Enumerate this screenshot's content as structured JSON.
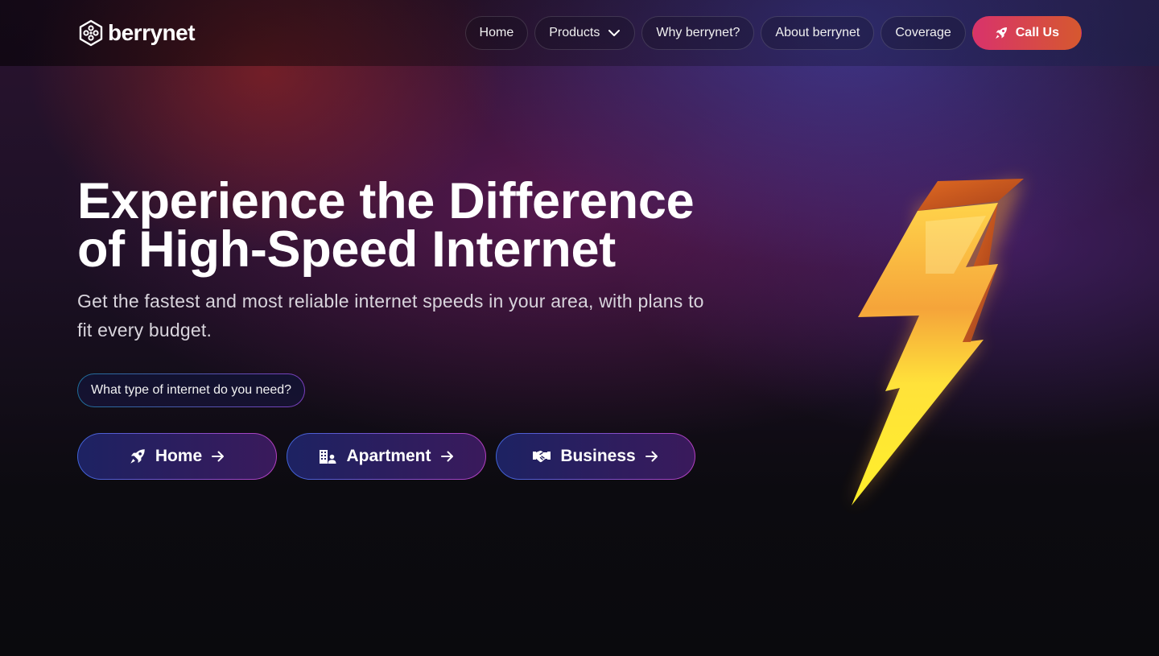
{
  "brand": {
    "name": "berrynet",
    "logo_icon": "berry-network-icon"
  },
  "nav": {
    "items": [
      {
        "label": "Home"
      },
      {
        "label": "Products",
        "icon": "chevron-down-icon"
      },
      {
        "label": "Why berrynet?"
      },
      {
        "label": "About berrynet"
      },
      {
        "label": "Coverage"
      }
    ],
    "cta": {
      "label": "Call Us",
      "icon": "rocket-icon"
    }
  },
  "hero": {
    "title_line1": "Experience the Difference",
    "title_line2": "of High-Speed Internet",
    "subtitle": "Get the fastest and most reliable internet speeds in your area, with plans to fit every budget.",
    "question": "What type of internet do you need?",
    "choices": [
      {
        "label": "Home",
        "icon": "rocket-icon"
      },
      {
        "label": "Apartment",
        "icon": "building-icon"
      },
      {
        "label": "Business",
        "icon": "handshake-icon"
      }
    ],
    "illustration": "lightning-bolt-icon"
  },
  "colors": {
    "cta_start": "#d8336b",
    "cta_end": "#d6582f",
    "background": "#0b0b0f"
  }
}
